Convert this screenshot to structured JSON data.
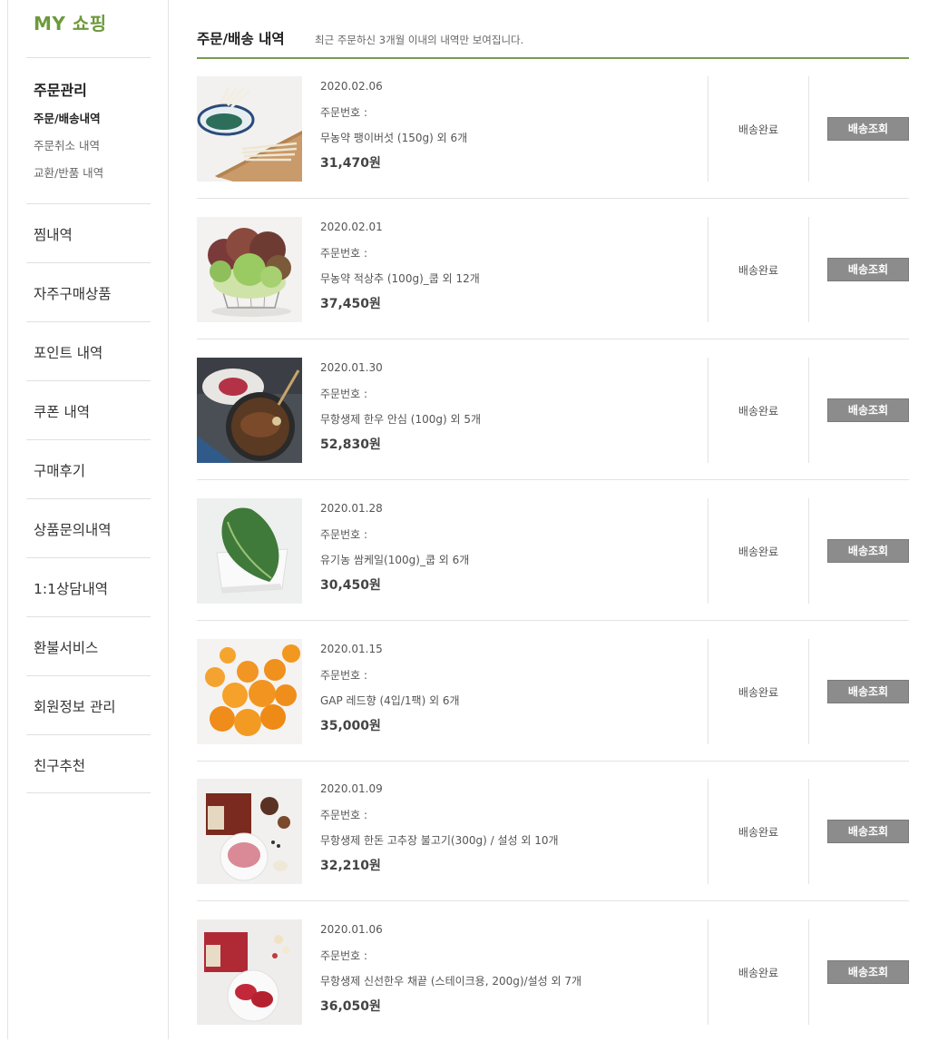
{
  "sidebar": {
    "title": "MY 쇼핑",
    "group_title": "주문관리",
    "sub_items": [
      "주문/배송내역",
      "주문취소 내역",
      "교환/반품 내역"
    ],
    "items": [
      "찜내역",
      "자주구매상품",
      "포인트 내역",
      "쿠폰 내역",
      "구매후기",
      "상품문의내역",
      "1:1상담내역",
      "환불서비스",
      "회원정보 관리",
      "친구추천"
    ]
  },
  "main": {
    "title": "주문/배송 내역",
    "note": "최근 주문하신 3개월 이내의 내역만 보여집니다."
  },
  "orders": [
    {
      "date": "2020.02.06",
      "order_no_label": "주문번호 :",
      "product": "무농약 팽이버섯 (150g) 외 6개",
      "price": "31,470원",
      "status": "배송완료",
      "button": "배송조회",
      "thumb": "mushroom-photo"
    },
    {
      "date": "2020.02.01",
      "order_no_label": "주문번호 :",
      "product": "무농약 적상추 (100g)_쿱 외 12개",
      "price": "37,450원",
      "status": "배송완료",
      "button": "배송조회",
      "thumb": "lettuce-photo"
    },
    {
      "date": "2020.01.30",
      "order_no_label": "주문번호 :",
      "product": "무항생제 한우 안심 (100g) 외 5개",
      "price": "52,830원",
      "status": "배송완료",
      "button": "배송조회",
      "thumb": "beef-steak-photo"
    },
    {
      "date": "2020.01.28",
      "order_no_label": "주문번호 :",
      "product": "유기농 쌈케일(100g)_쿱 외 6개",
      "price": "30,450원",
      "status": "배송완료",
      "button": "배송조회",
      "thumb": "kale-photo"
    },
    {
      "date": "2020.01.15",
      "order_no_label": "주문번호 :",
      "product": "GAP 레드향 (4입/1팩) 외 6개",
      "price": "35,000원",
      "status": "배송완료",
      "button": "배송조회",
      "thumb": "tangerine-photo"
    },
    {
      "date": "2020.01.09",
      "order_no_label": "주문번호 :",
      "product": "무항생제 한돈 고추장 불고기(300g) / 설성 외 10개",
      "price": "32,210원",
      "status": "배송완료",
      "button": "배송조회",
      "thumb": "pork-bulgogi-photo"
    },
    {
      "date": "2020.01.06",
      "order_no_label": "주문번호 :",
      "product": "무항생제 신선한우 채끝 (스테이크용, 200g)/설성 외 7개",
      "price": "36,050원",
      "status": "배송완료",
      "button": "배송조회",
      "thumb": "beef-sirloin-photo"
    }
  ],
  "colors": {
    "accent": "#6d9a3c",
    "rule": "#7a9a4f",
    "button_bg": "#8c8c8c"
  }
}
